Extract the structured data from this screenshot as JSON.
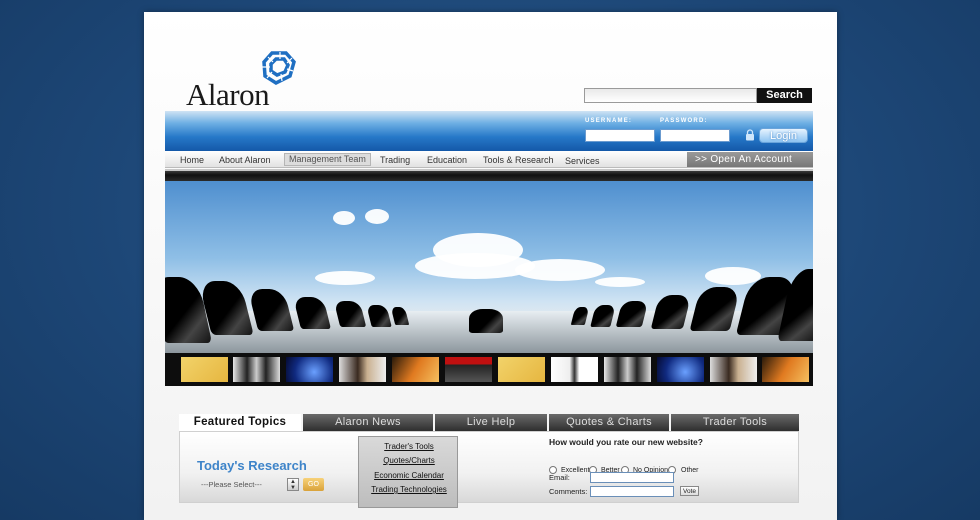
{
  "brand": {
    "name": "Alaron",
    "accent": "#1458a8"
  },
  "search": {
    "button_label": "Search",
    "value": ""
  },
  "login": {
    "username_label": "USERNAME:",
    "password_label": "PASSWORD:",
    "username_value": "",
    "password_value": "",
    "button_label": "Login",
    "lock_icon": "lock-icon"
  },
  "nav": {
    "items": [
      {
        "label": "Home"
      },
      {
        "label": "About Alaron"
      },
      {
        "label": "Management Team",
        "active": true
      },
      {
        "label": "Trading"
      },
      {
        "label": "Education"
      },
      {
        "label": "Tools & Research"
      },
      {
        "label": "Services"
      }
    ],
    "open_account": ">>  Open An Account"
  },
  "tabs": [
    {
      "label": "Featured Topics",
      "active": true
    },
    {
      "label": "Alaron News"
    },
    {
      "label": "Live Help"
    },
    {
      "label": "Quotes & Charts"
    },
    {
      "label": "Trader Tools"
    }
  ],
  "research": {
    "title": "Today's Research",
    "select_value": "---Please Select---",
    "go_label": "GO"
  },
  "links": [
    "Trader's Tools",
    "Quotes/Charts",
    "Economic Calendar",
    "Trading Technologies"
  ],
  "poll": {
    "question": "How would you rate our new website?",
    "options": [
      "Excellent",
      "Better",
      "No Opinion",
      "Other"
    ],
    "email_label": "Email:",
    "comments_label": "Comments:",
    "vote_label": "Vote"
  }
}
